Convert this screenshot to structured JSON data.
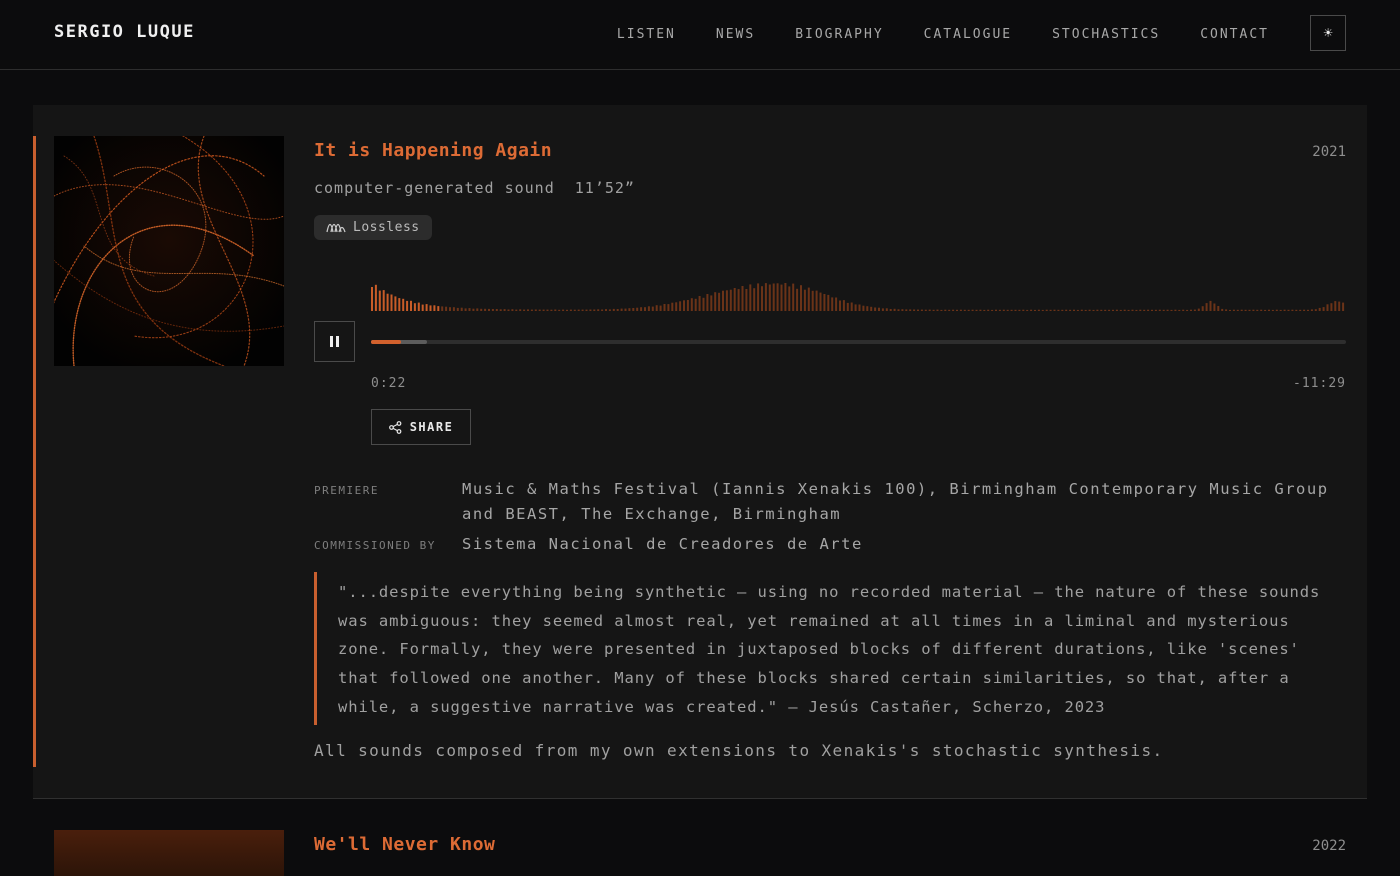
{
  "header": {
    "site_title": "SERGIO LUQUE",
    "nav": [
      "LISTEN",
      "NEWS",
      "BIOGRAPHY",
      "CATALOGUE",
      "STOCHASTICS",
      "CONTACT"
    ],
    "theme_toggle_icon": "sun-icon",
    "theme_toggle_glyph": "☀"
  },
  "colors": {
    "accent": "#dd6b35",
    "background": "#0c0c0d",
    "card": "#151515"
  },
  "work": {
    "title": "It is Happening Again",
    "year": "2021",
    "medium": "computer-generated sound",
    "duration": "11’52”",
    "badge": "Lossless",
    "player": {
      "elapsed": "0:22",
      "remaining": "-11:29",
      "progress": 0.031,
      "buffered": 0.057,
      "state": "playing",
      "share_label": "SHARE"
    },
    "premiere_label": "PREMIERE",
    "premiere": "Music & Maths Festival (Iannis Xenakis 100), Birmingham Contemporary Music Group and BEAST, The Exchange, Birmingham",
    "commissioned_label": "COMMISSIONED BY",
    "commissioned": "Sistema Nacional de Creadores de Arte",
    "quote": "\"...despite everything being synthetic – using no recorded material – the nature of these sounds was ambiguous: they seemed almost real, yet remained at all times in a liminal and mysterious zone. Formally, they were presented in juxtaposed blocks of different durations, like 'scenes' that followed one another. Many of these blocks shared certain similarities, so that, after a while, a suggestive narrative was created.\" – Jesús Castañer, Scherzo, 2023",
    "note": "All sounds composed from my own extensions to Xenakis's stochastic synthesis."
  },
  "next_work": {
    "title": "We'll Never Know",
    "year": "2022"
  }
}
